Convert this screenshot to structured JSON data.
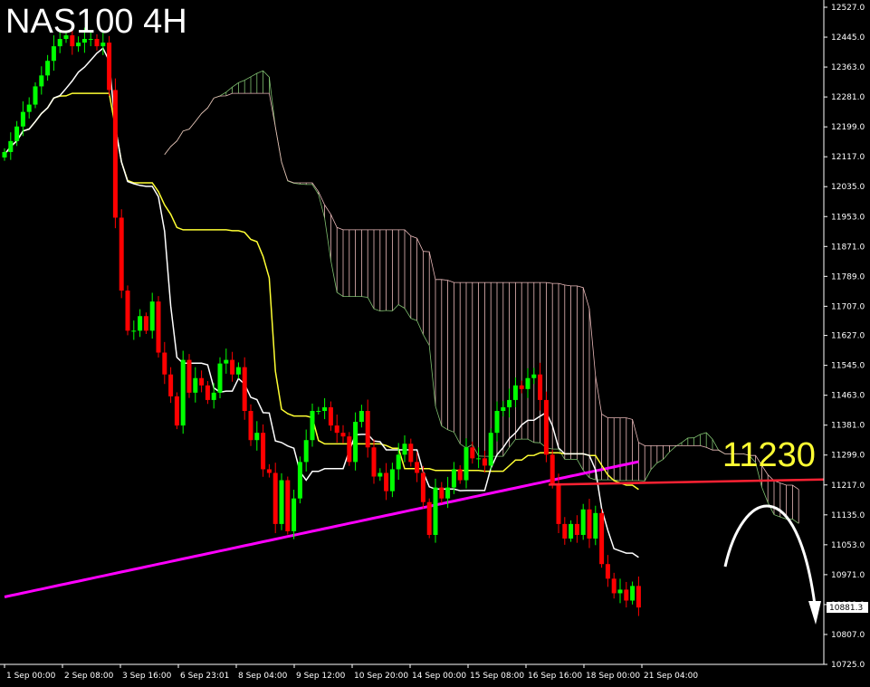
{
  "title": "NAS100 4H",
  "chart_data": {
    "type": "candlestick",
    "symbol": "NAS100",
    "timeframe": "4H",
    "current_price": "10881.3",
    "annotation_level": "11230",
    "ylim": [
      10725,
      12527
    ],
    "y_ticks": [
      "12527.0",
      "12445.0",
      "12363.0",
      "12281.0",
      "12199.0",
      "12117.0",
      "12035.0",
      "11953.0",
      "11871.0",
      "11789.0",
      "11707.0",
      "11627.0",
      "11545.0",
      "11463.0",
      "11381.0",
      "11299.0",
      "11217.0",
      "11135.0",
      "11053.0",
      "10971.0",
      "10889.0",
      "10807.0",
      "10725.0"
    ],
    "x_ticks": [
      "1 Sep 00:00",
      "2 Sep 08:00",
      "3 Sep 16:00",
      "6 Sep 23:01",
      "8 Sep 04:00",
      "9 Sep 12:00",
      "10 Sep 20:00",
      "14 Sep 00:00",
      "15 Sep 08:00",
      "16 Sep 16:00",
      "18 Sep 00:00",
      "21 Sep 04:00"
    ],
    "close_seed": [
      12130,
      12160,
      12200,
      12240,
      12260,
      12310,
      12340,
      12380,
      12420,
      12440,
      12450,
      12420,
      12430,
      12440,
      12440,
      12420,
      12430,
      12300,
      11950,
      11750,
      11640,
      11640,
      11680,
      11640,
      11720,
      11580,
      11520,
      11460,
      11380,
      11560,
      11470,
      11510,
      11490,
      11450,
      11470,
      11550,
      11560,
      11520,
      11540,
      11420,
      11340,
      11360,
      11260,
      11250,
      11110,
      11230,
      11090,
      11180,
      11280,
      11340,
      11420,
      11420,
      11430,
      11380,
      11360,
      11350,
      11280,
      11390,
      11420,
      11320,
      11240,
      11250,
      11200,
      11260,
      11300,
      11330,
      11280,
      11250,
      11170,
      11080,
      11210,
      11180,
      11210,
      11260,
      11230,
      11320,
      11290,
      11290,
      11270,
      11360,
      11420,
      11430,
      11450,
      11490,
      11480,
      11510,
      11520,
      11450,
      11300,
      11220,
      11110,
      11070,
      11110,
      11080,
      11150,
      11070,
      11140,
      11000,
      10960,
      10920,
      10930,
      10900,
      10940,
      10881
    ]
  },
  "colors": {
    "bull": "#00ff00",
    "bear": "#ff0000",
    "tenkan": "#ffffff",
    "kijun": "#ffff33",
    "ma": "#ff00ff",
    "level_line": "#ff2233",
    "cloud_bull": "#7fbf6f",
    "cloud_bear": "#e8b8b8"
  }
}
